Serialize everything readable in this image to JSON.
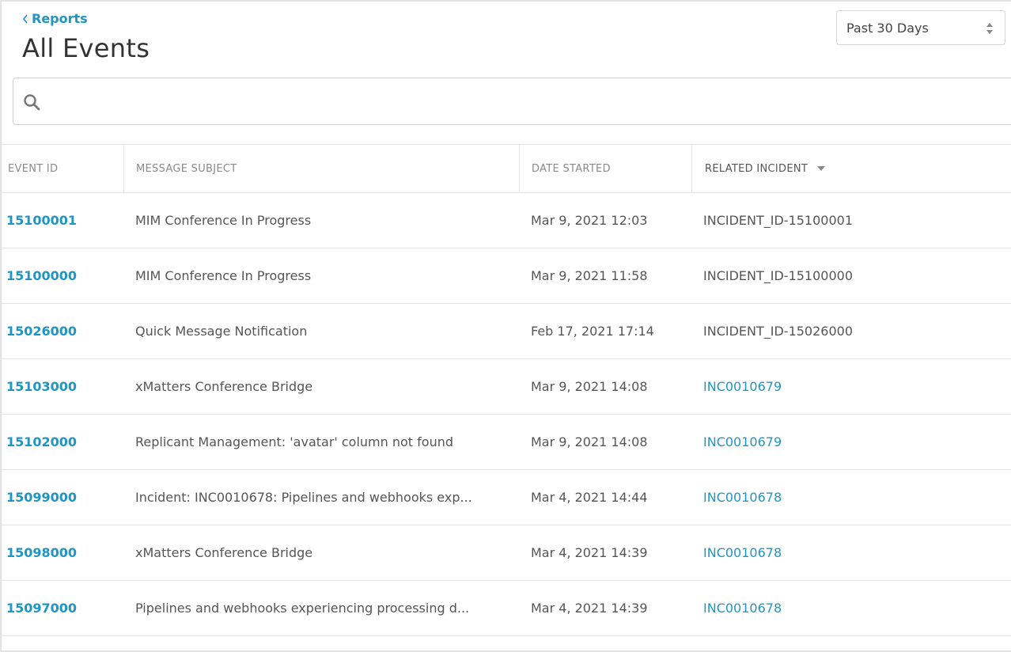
{
  "nav": {
    "back_label": "Reports"
  },
  "page": {
    "title": "All Events"
  },
  "date_range": {
    "selected": "Past 30 Days"
  },
  "search": {
    "value": "",
    "placeholder": ""
  },
  "table": {
    "columns": {
      "event_id": "EVENT ID",
      "subject": "MESSAGE SUBJECT",
      "date": "DATE STARTED",
      "incident": "RELATED INCIDENT"
    },
    "rows": [
      {
        "event_id": "15100001",
        "subject": "MIM Conference In Progress",
        "date": "Mar 9, 2021 12:03",
        "incident": "INCIDENT_ID-15100001",
        "incident_link": false
      },
      {
        "event_id": "15100000",
        "subject": "MIM Conference In Progress",
        "date": "Mar 9, 2021 11:58",
        "incident": "INCIDENT_ID-15100000",
        "incident_link": false
      },
      {
        "event_id": "15026000",
        "subject": "Quick Message Notification",
        "date": "Feb 17, 2021 17:14",
        "incident": "INCIDENT_ID-15026000",
        "incident_link": false
      },
      {
        "event_id": "15103000",
        "subject": "xMatters Conference Bridge",
        "date": "Mar 9, 2021 14:08",
        "incident": "INC0010679",
        "incident_link": true
      },
      {
        "event_id": "15102000",
        "subject": "Replicant Management: 'avatar' column not found",
        "date": "Mar 9, 2021 14:08",
        "incident": "INC0010679",
        "incident_link": true
      },
      {
        "event_id": "15099000",
        "subject": "Incident: INC0010678: Pipelines and webhooks exp...",
        "date": "Mar 4, 2021 14:44",
        "incident": "INC0010678",
        "incident_link": true
      },
      {
        "event_id": "15098000",
        "subject": "xMatters Conference Bridge",
        "date": "Mar 4, 2021 14:39",
        "incident": "INC0010678",
        "incident_link": true
      },
      {
        "event_id": "15097000",
        "subject": "Pipelines and webhooks experiencing processing d...",
        "date": "Mar 4, 2021 14:39",
        "incident": "INC0010678",
        "incident_link": true
      }
    ]
  },
  "colors": {
    "link": "#1f95c4",
    "text": "#555555",
    "header_text": "#8a8a8a",
    "border": "#e6e6e6"
  }
}
